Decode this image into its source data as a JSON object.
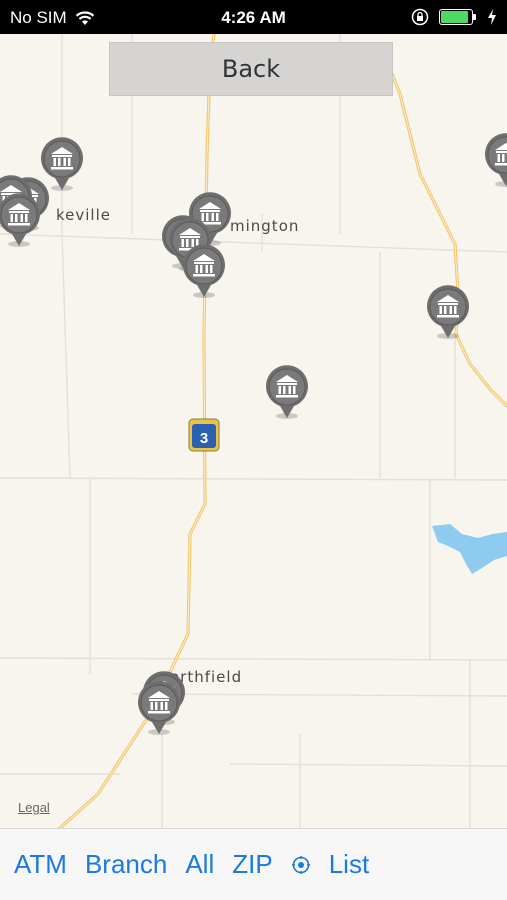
{
  "status_bar": {
    "carrier": "No SIM",
    "time": "4:26 AM",
    "battery_level": 0.9
  },
  "back_label": "Back",
  "map": {
    "places": [
      "keville",
      "mington",
      "orthfield"
    ],
    "highway_number": "3",
    "legal": "Legal"
  },
  "toolbar": {
    "items": [
      "ATM",
      "Branch",
      "All",
      "ZIP",
      "List"
    ]
  },
  "colors": {
    "accent": "#1a7ae0",
    "road_major": "#f5c96a",
    "water": "#8ecbf0",
    "pin": "#6e6e6e"
  }
}
